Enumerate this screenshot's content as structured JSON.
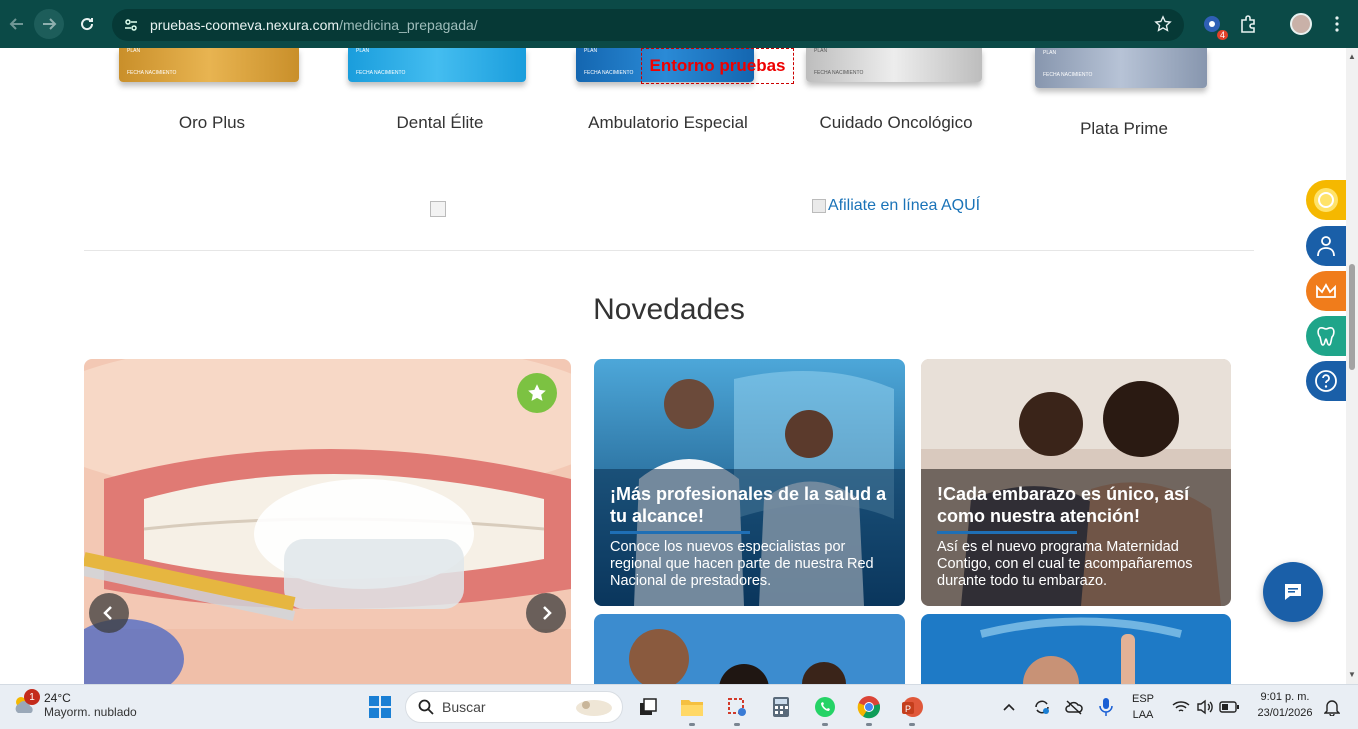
{
  "browser": {
    "url_host": "pruebas-coomeva.nexura.com",
    "url_path": "/medicina_prepagada/",
    "extension_badge": "4"
  },
  "plans": [
    {
      "name": "Oro Plus",
      "color": "#d9a13a"
    },
    {
      "name": "Dental Élite",
      "color": "#2aa6e0"
    },
    {
      "name": "Ambulatorio Especial",
      "color": "#1e7cc8"
    },
    {
      "name": "Cuidado Oncológico",
      "color": "#cfcfcf"
    },
    {
      "name": "Plata Prime",
      "color": "#98a8c0"
    }
  ],
  "environment_label": "Entorno pruebas",
  "afiliate_link": "Afiliate en línea AQUÍ",
  "novedades": {
    "title": "Novedades",
    "cards": [
      {
        "title": "¡Más profesionales de la salud a tu alcance!",
        "text": "Conoce los nuevos especialistas por regional que hacen parte de nuestra Red Nacional de prestadores."
      },
      {
        "title": "!Cada embarazo es único, así como nuestra atención!",
        "text": "Así es el nuevo programa Maternidad Contigo, con el cual te acompañaremos durante todo tu embarazo."
      }
    ]
  },
  "side_buttons": [
    {
      "icon": "coin-icon",
      "color": "#f5b800"
    },
    {
      "icon": "doctor-icon",
      "color": "#1a5fa8"
    },
    {
      "icon": "crown-icon",
      "color": "#f07c1b"
    },
    {
      "icon": "tooth-icon",
      "color": "#1fa58a"
    },
    {
      "icon": "help-icon",
      "color": "#1a5fa8"
    }
  ],
  "taskbar": {
    "weather_temp": "24°C",
    "weather_desc": "Mayorm. nublado",
    "weather_badge": "1",
    "search_placeholder": "Buscar",
    "lang_top": "ESP",
    "lang_bottom": "LAA",
    "time": "9:01 p. m.",
    "date": "23/01/2026"
  }
}
